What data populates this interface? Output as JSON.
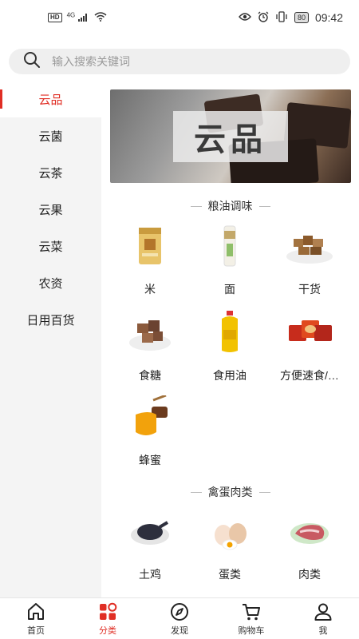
{
  "status_bar": {
    "hd": "HD",
    "network": "4G",
    "battery": "80",
    "time": "09:42"
  },
  "search": {
    "placeholder": "输入搜索关键词"
  },
  "sidebar": {
    "items": [
      {
        "label": "云品",
        "active": true
      },
      {
        "label": "云菌"
      },
      {
        "label": "云茶"
      },
      {
        "label": "云果"
      },
      {
        "label": "云菜"
      },
      {
        "label": "农资"
      },
      {
        "label": "日用百货"
      }
    ]
  },
  "banner": {
    "text": "云品"
  },
  "sections": [
    {
      "title": "粮油调味",
      "items": [
        {
          "label": "米",
          "icon": "rice-bag-icon"
        },
        {
          "label": "面",
          "icon": "noodles-pack-icon"
        },
        {
          "label": "干货",
          "icon": "dried-goods-icon"
        },
        {
          "label": "食糖",
          "icon": "sugar-icon"
        },
        {
          "label": "食用油",
          "icon": "cooking-oil-icon"
        },
        {
          "label": "方便速食/…",
          "icon": "instant-food-icon"
        },
        {
          "label": "蜂蜜",
          "icon": "honey-icon"
        }
      ]
    },
    {
      "title": "禽蛋肉类",
      "items": [
        {
          "label": "土鸡",
          "icon": "chicken-icon"
        },
        {
          "label": "蛋类",
          "icon": "eggs-icon"
        },
        {
          "label": "肉类",
          "icon": "meat-icon"
        }
      ]
    }
  ],
  "tabbar": {
    "items": [
      {
        "label": "首页",
        "icon": "home-icon"
      },
      {
        "label": "分类",
        "icon": "category-icon",
        "active": true
      },
      {
        "label": "发现",
        "icon": "compass-icon"
      },
      {
        "label": "购物车",
        "icon": "cart-icon"
      },
      {
        "label": "我",
        "icon": "user-icon"
      }
    ]
  },
  "colors": {
    "accent": "#e02e24",
    "sidebar_bg": "#f4f4f4"
  }
}
